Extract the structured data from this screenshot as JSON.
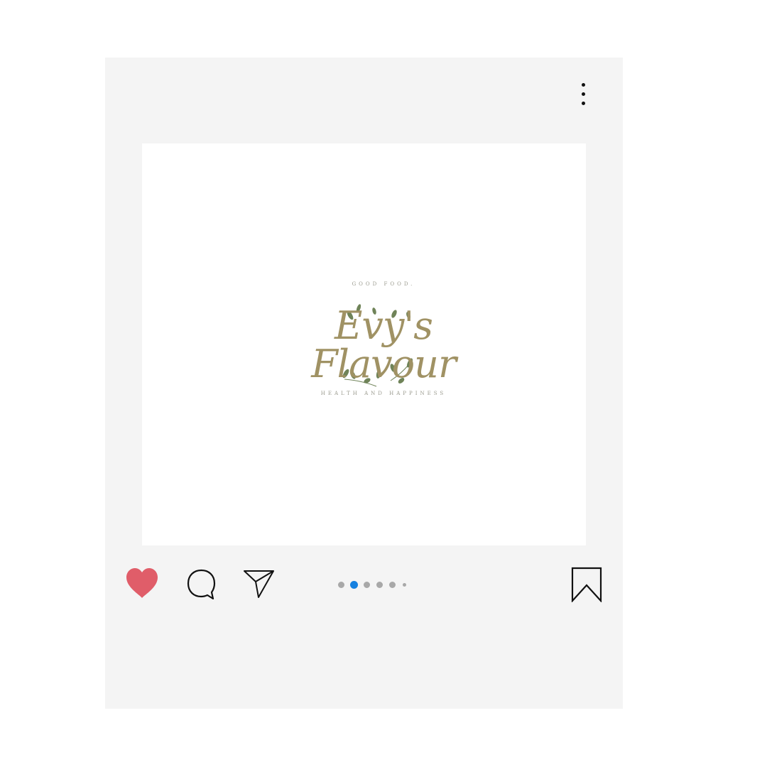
{
  "post": {
    "menu_icon": "more-vertical-icon",
    "image": {
      "logo": {
        "name": "Evy's Flavour",
        "tagline_top": "GOOD FOOD.",
        "tagline_bottom": "HEALTH AND HAPPINESS",
        "name_color": "#a09264",
        "leaf_color": "#6f8358"
      }
    },
    "actions": {
      "like": {
        "icon": "heart-icon",
        "liked": true,
        "color": "#e05d69"
      },
      "comment": {
        "icon": "comment-icon"
      },
      "share": {
        "icon": "send-icon"
      },
      "save": {
        "icon": "bookmark-icon"
      }
    },
    "carousel": {
      "total_dots": 6,
      "active_index": 1,
      "active_color": "#1681e0",
      "inactive_color": "#a8a8a8"
    }
  }
}
